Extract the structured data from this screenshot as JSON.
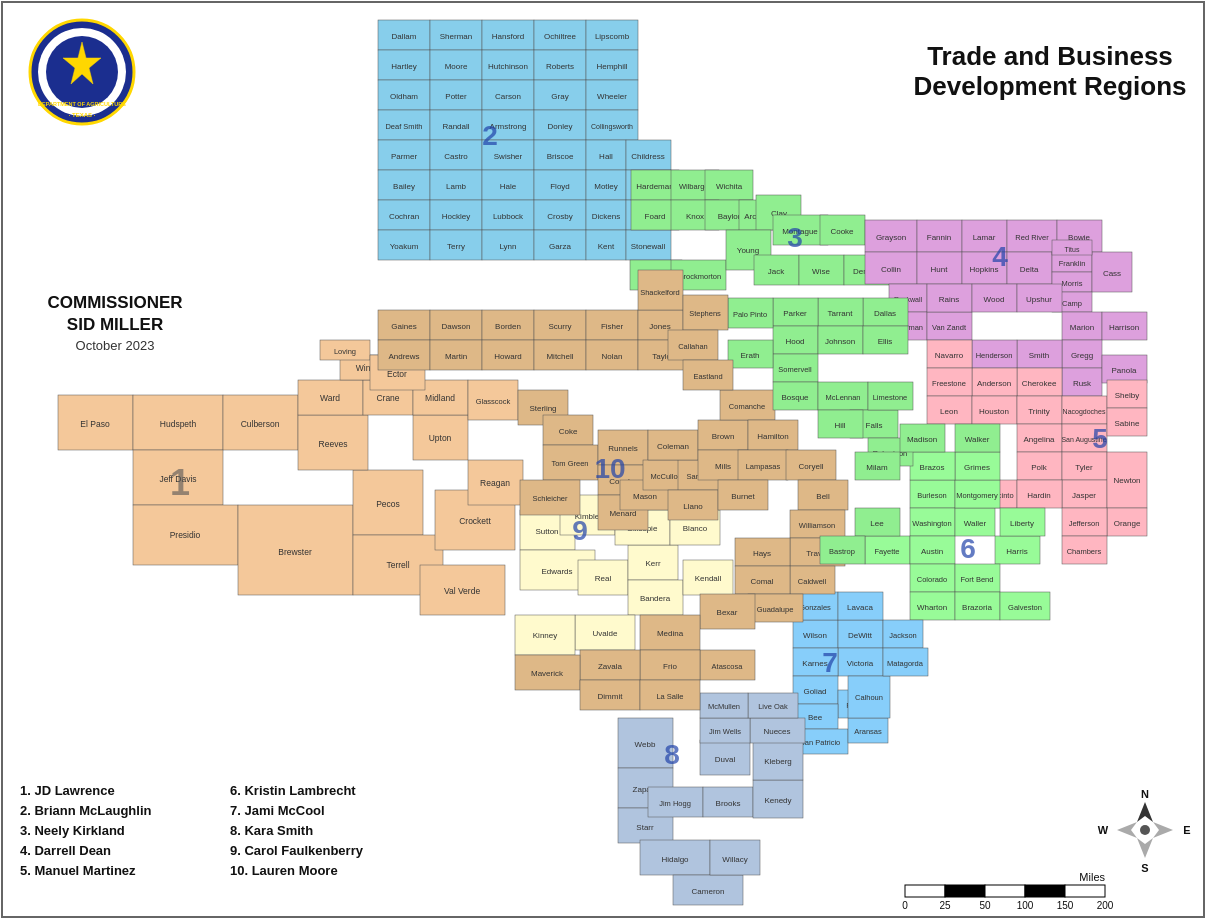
{
  "header": {
    "title": "Trade and Business\nDevelopment Regions",
    "commissioner_label": "COMMISSIONER\nSID MILLER",
    "date": "October 2023"
  },
  "legend": {
    "col1": [
      {
        "num": "1.",
        "name": "JD Lawrence"
      },
      {
        "num": "2.",
        "name": "Briann McLaughlin"
      },
      {
        "num": "3.",
        "name": "Neely Kirkland"
      },
      {
        "num": "4.",
        "name": "Darrell Dean"
      },
      {
        "num": "5.",
        "name": "Manuel Martinez"
      }
    ],
    "col2": [
      {
        "num": "6.",
        "name": "Kristin Lambrecht"
      },
      {
        "num": "7.",
        "name": "Jami McCool"
      },
      {
        "num": "8.",
        "name": "Kara Smith"
      },
      {
        "num": "9.",
        "name": "Carol Faulkenberry"
      },
      {
        "num": "10.",
        "name": "Lauren Moore"
      }
    ]
  },
  "scale": {
    "labels": [
      "0",
      "25",
      "50",
      "100",
      "150",
      "200"
    ],
    "unit": "Miles"
  },
  "regions": {
    "1": {
      "color": "#F4C89A",
      "label": "1"
    },
    "2": {
      "color": "#87CEEB",
      "label": "2"
    },
    "3": {
      "color": "#90EE90",
      "label": "3"
    },
    "4": {
      "color": "#DDA0DD",
      "label": "4"
    },
    "5": {
      "color": "#FFB6C1",
      "label": "5"
    },
    "6": {
      "color": "#98FB98",
      "label": "6"
    },
    "7": {
      "color": "#87CEFA",
      "label": "7"
    },
    "8": {
      "color": "#B0C4DE",
      "label": "8"
    },
    "9": {
      "color": "#FFFACD",
      "label": "9"
    },
    "10": {
      "color": "#DEB887",
      "label": "10"
    }
  }
}
